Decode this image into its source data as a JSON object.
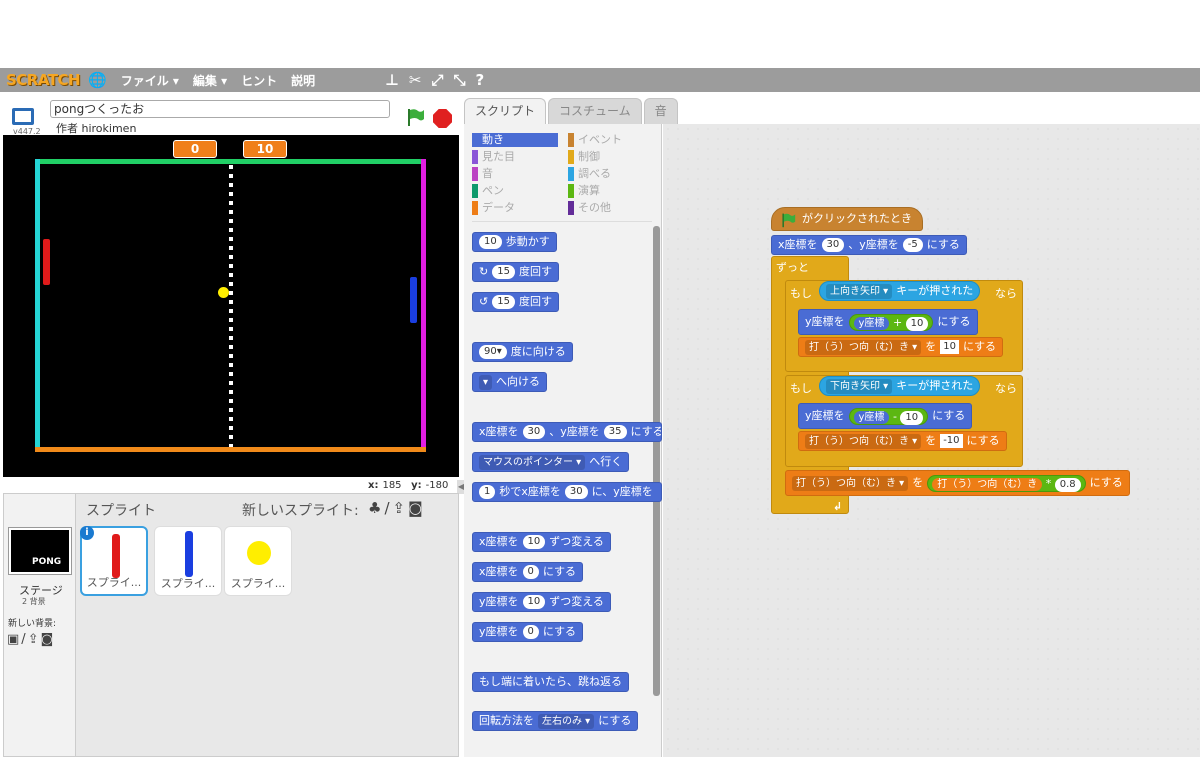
{
  "menubar": {
    "logo": "SCRATCH",
    "items": [
      "ファイル ▾",
      "編集 ▾",
      "ヒント",
      "説明"
    ]
  },
  "stage_header": {
    "version": "v447.2",
    "project_title": "pongつくったお",
    "author": "作者 hirokimen"
  },
  "stage": {
    "score_left": "0",
    "score_right": "10",
    "coords_x_label": "x:",
    "coords_x": "185",
    "coords_y_label": "y:",
    "coords_y": "-180"
  },
  "sprite_pane": {
    "title": "スプライト",
    "new_sprite": "新しいスプライト:",
    "stage_label": "ステージ",
    "stage_sub": "2 背景",
    "new_backdrop": "新しい背景:",
    "stage_thumb_text": "PONG",
    "sprites": [
      "スプライ...",
      "スプライ...",
      "スプライ..."
    ]
  },
  "tabs": [
    "スクリプト",
    "コスチューム",
    "音"
  ],
  "categories": {
    "left": [
      "動き",
      "見た目",
      "音",
      "ペン",
      "データ"
    ],
    "right": [
      "イベント",
      "制御",
      "調べる",
      "演算",
      "その他"
    ]
  },
  "colors": {
    "motion": "#4a6cd4",
    "looks": "#8a55d7",
    "sound": "#bb42c3",
    "pen": "#0e9a6c",
    "data": "#ee7d16",
    "events": "#c88330",
    "control": "#e1a91a",
    "sensing": "#2ca5e2",
    "operators": "#5cb712",
    "more": "#632d99"
  },
  "palette_blocks": {
    "move": {
      "n": "10",
      "t": "歩動かす"
    },
    "turn_right": {
      "n": "15",
      "t": "度回す"
    },
    "turn_left": {
      "n": "15",
      "t": "度回す"
    },
    "point_dir": {
      "n": "90▾",
      "t": "度に向ける"
    },
    "point_towards": {
      "t": "へ向ける"
    },
    "goto_xy": {
      "a": "x座標を",
      "x": "30",
      "b": "、y座標を",
      "y": "35",
      "c": "にする"
    },
    "goto": {
      "dd": "マウスのポインター ▾",
      "t": "へ行く"
    },
    "glide": {
      "n": "1",
      "a": "秒でx座標を",
      "x": "30",
      "b": "に、y座標を"
    },
    "change_x": {
      "a": "x座標を",
      "n": "10",
      "b": "ずつ変える"
    },
    "set_x": {
      "a": "x座標を",
      "n": "0",
      "b": "にする"
    },
    "change_y": {
      "a": "y座標を",
      "n": "10",
      "b": "ずつ変える"
    },
    "set_y": {
      "a": "y座標を",
      "n": "0",
      "b": "にする"
    },
    "bounce": "もし端に着いたら、跳ね返る",
    "rotation": {
      "a": "回転方法を",
      "dd": "左右のみ ▾",
      "b": "にする"
    }
  },
  "script": {
    "hat": "がクリックされたとき",
    "goto": {
      "a": "x座標を",
      "x": "30",
      "b": "、y座標を",
      "y": "-5",
      "c": "にする"
    },
    "forever": "ずっと",
    "if1": {
      "kw": "もし",
      "key": "上向き矢印 ▾",
      "k": "キーが押された",
      "then": "なら"
    },
    "if1_set_y": {
      "a": "y座標を",
      "var": "y座標",
      "op": "+",
      "n": "10",
      "b": "にする"
    },
    "if1_set_var": {
      "dd": "打（う）つ向（む）き ▾",
      "a": "を",
      "n": "10",
      "b": "にする"
    },
    "if2": {
      "kw": "もし",
      "key": "下向き矢印 ▾",
      "k": "キーが押された",
      "then": "なら"
    },
    "if2_set_y": {
      "a": "y座標を",
      "var": "y座標",
      "op": "-",
      "n": "10",
      "b": "にする"
    },
    "if2_set_var": {
      "dd": "打（う）つ向（む）き ▾",
      "a": "を",
      "n": "-10",
      "b": "にする"
    },
    "final_set": {
      "dd": "打（う）つ向（む）き ▾",
      "a": "を",
      "var": "打（う）つ向（む）き",
      "op": "*",
      "n": "0.8",
      "b": "にする"
    }
  }
}
